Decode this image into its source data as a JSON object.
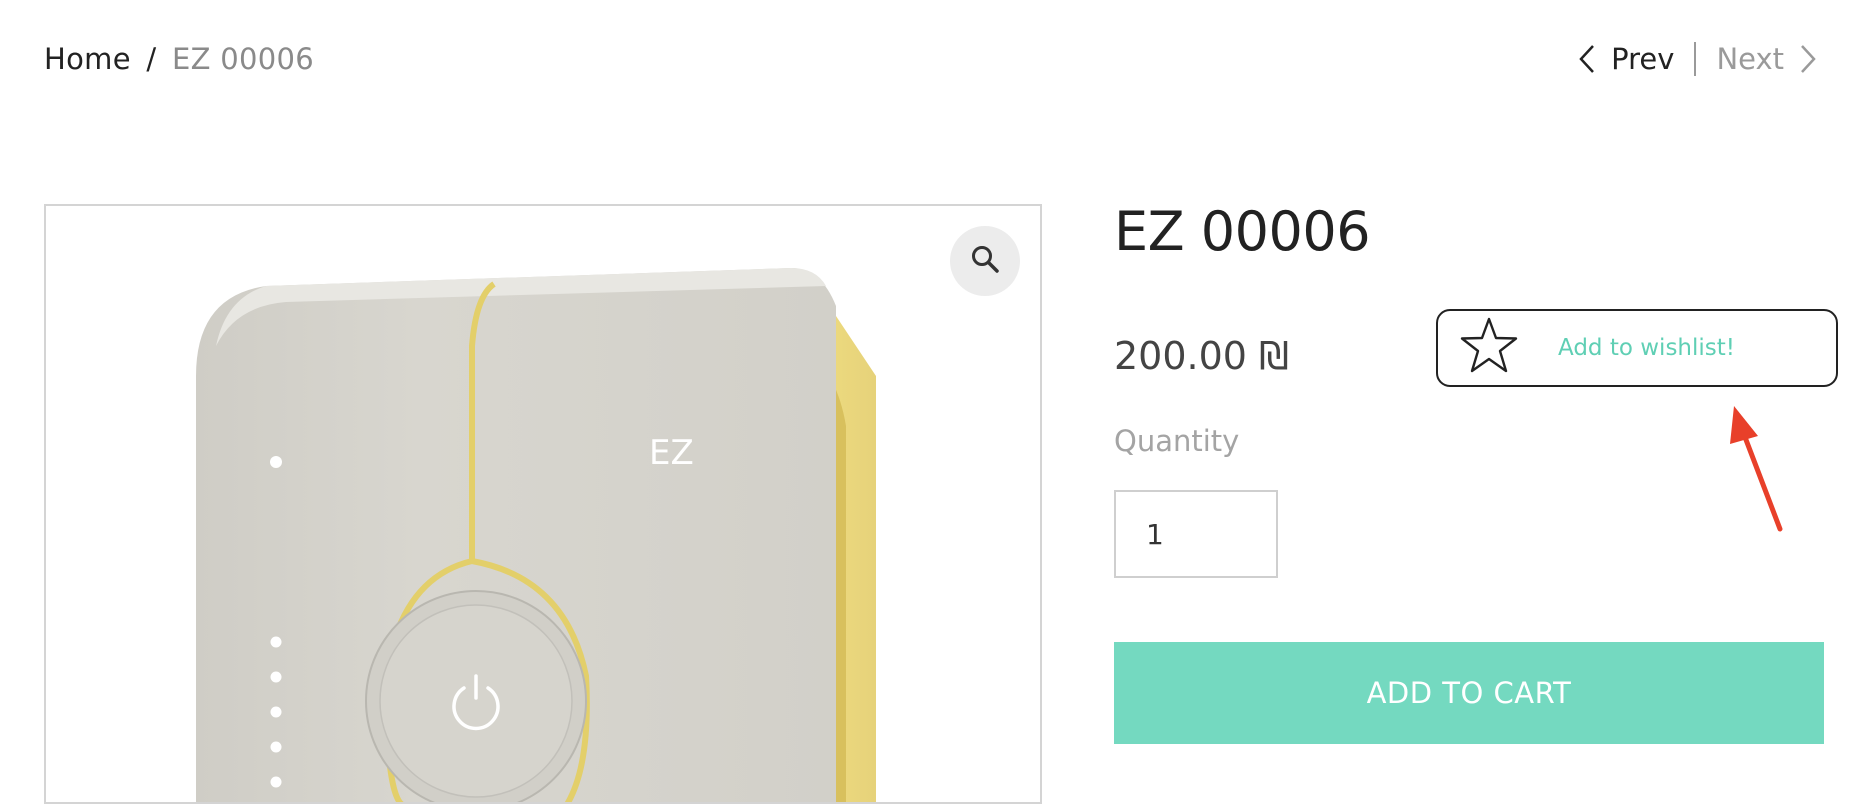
{
  "breadcrumb": {
    "home": "Home",
    "separator": "/",
    "current": "EZ 00006"
  },
  "pager": {
    "prev": "Prev",
    "next": "Next"
  },
  "product": {
    "title": "EZ 00006",
    "price": "200.00 ₪",
    "quantity_label": "Quantity",
    "quantity_value": "1",
    "device_logo": "EZ"
  },
  "wishlist": {
    "label": "Add to wishlist!",
    "icon": "star-icon"
  },
  "cart": {
    "label": "ADD TO CART"
  },
  "colors": {
    "accent": "#74d9c0",
    "wishlist_text": "#5fcfb4",
    "annotation_arrow": "#e8402a"
  }
}
